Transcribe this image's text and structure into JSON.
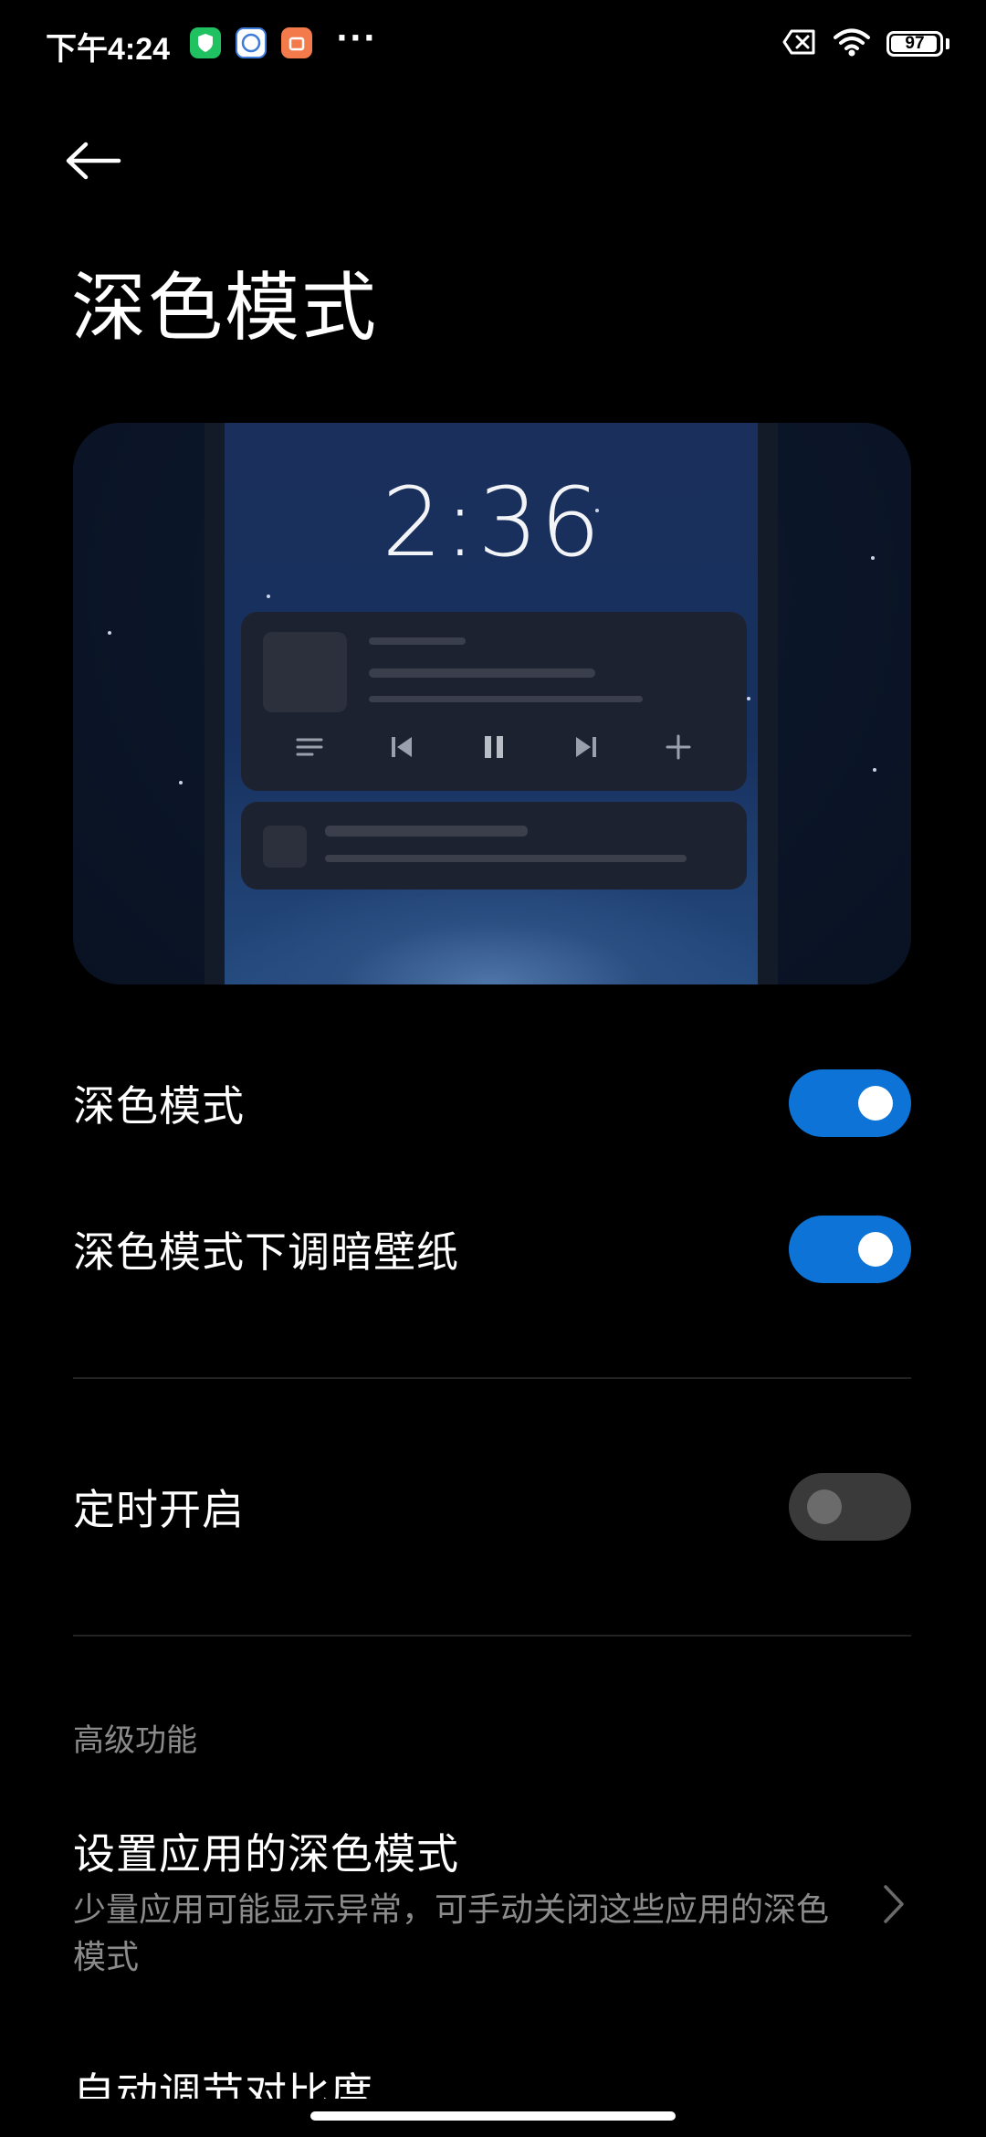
{
  "status_bar": {
    "time": "下午4:24",
    "more_dots": "···",
    "battery_level": "97",
    "icons": [
      "security-app-icon",
      "browser-app-icon",
      "store-app-icon",
      "no-sim-icon",
      "wifi-icon",
      "battery-icon"
    ]
  },
  "header": {
    "back_icon": "arrow-left-icon",
    "title": "深色模式"
  },
  "preview": {
    "lock_time": "2:36",
    "media_controls": [
      "playlist-icon",
      "previous-icon",
      "pause-icon",
      "next-icon",
      "plus-icon"
    ]
  },
  "settings": {
    "dark_mode": {
      "label": "深色模式",
      "enabled": true
    },
    "dim_wallpaper": {
      "label": "深色模式下调暗壁纸",
      "enabled": true
    },
    "scheduled": {
      "label": "定时开启",
      "enabled": false
    }
  },
  "advanced": {
    "section_label": "高级功能",
    "app_dark_mode": {
      "title": "设置应用的深色模式",
      "description": "少量应用可能显示异常，可手动关闭这些应用的深色模式"
    },
    "partial_item": "自动调节对比度"
  },
  "colors": {
    "background": "#000000",
    "accent": "#0d73d6",
    "toggle_off": "#3a3a3a",
    "secondary_text": "#8b8b8b"
  }
}
